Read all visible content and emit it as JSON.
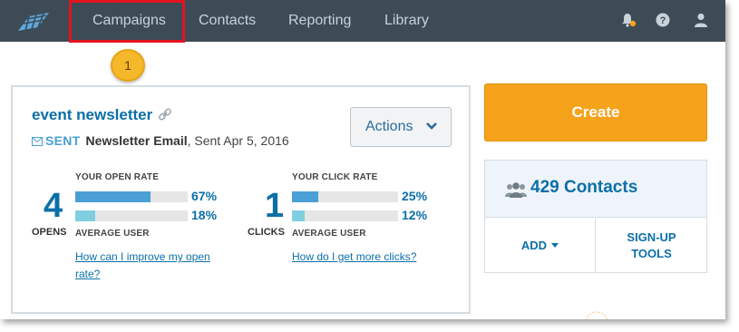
{
  "nav": {
    "items": [
      "Campaigns",
      "Contacts",
      "Reporting",
      "Library"
    ],
    "icons": [
      "notifications-icon",
      "help-icon",
      "user-icon"
    ],
    "notification_dot_color": "#f6a21b"
  },
  "callout": {
    "number": "1"
  },
  "campaign": {
    "title": "event newsletter",
    "status": "SENT",
    "email_type": "Newsletter Email",
    "sent_date": ", Sent Apr 5, 2016",
    "actions_label": "Actions",
    "opens": {
      "rate_label": "YOUR OPEN RATE",
      "count": "4",
      "unit": "OPENS",
      "your_rate": 67,
      "your_rate_text": "67%",
      "avg_rate": 18,
      "avg_rate_text": "18%",
      "avg_label": "AVERAGE USER",
      "help_link": "How can I improve my open rate?"
    },
    "clicks": {
      "rate_label": "YOUR CLICK RATE",
      "count": "1",
      "unit": "CLICKS",
      "your_rate": 25,
      "your_rate_text": "25%",
      "avg_rate": 12,
      "avg_rate_text": "12%",
      "avg_label": "AVERAGE USER",
      "help_link": "How do I get more clicks?"
    }
  },
  "create": {
    "label": "Create"
  },
  "contacts": {
    "count_label": "429 Contacts",
    "add_label": "ADD",
    "signup_label_line1": "SIGN-UP",
    "signup_label_line2": "TOOLS"
  },
  "colors": {
    "nav_bg": "#3d4b56",
    "accent_blue": "#0b6fa8",
    "your_bar": "#4a9fd6",
    "avg_bar": "#7fcfe0",
    "create_orange": "#f6a21b",
    "highlight_red": "#e3141f"
  }
}
